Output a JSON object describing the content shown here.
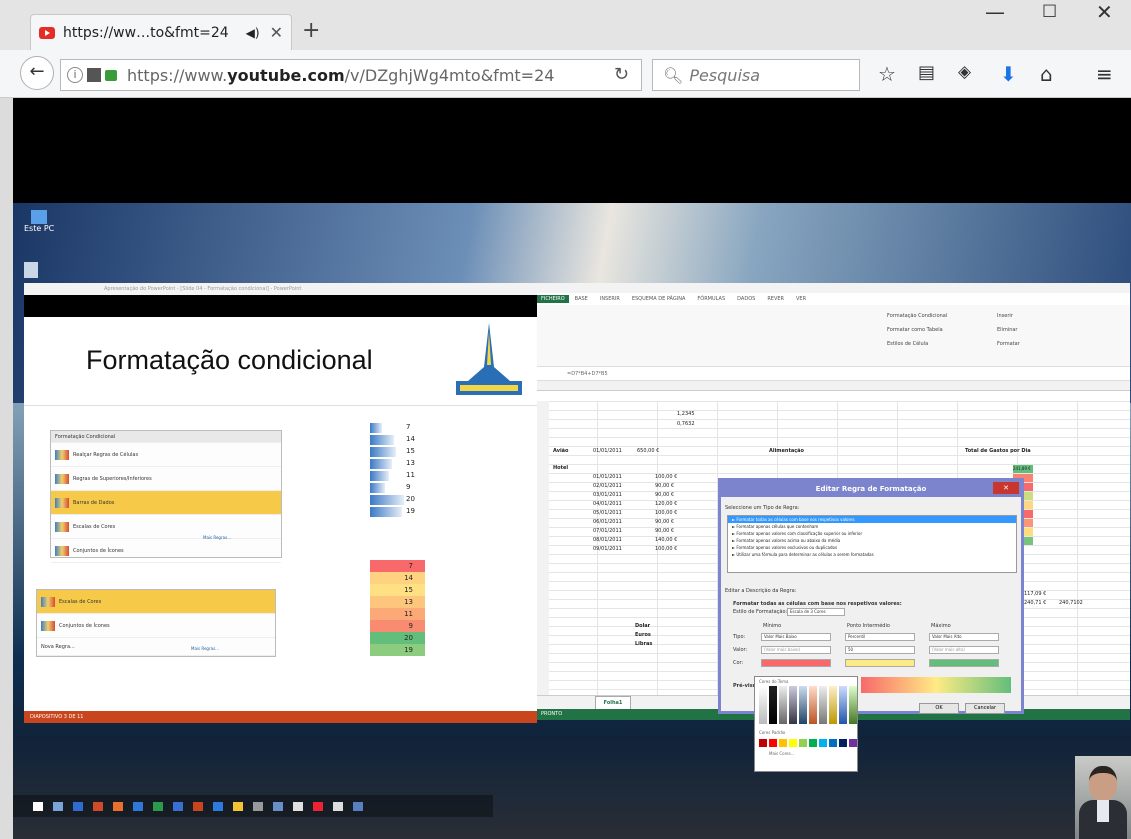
{
  "browser": {
    "tab_title": "https://ww…to&fmt=24",
    "url_prefix": "https://www.",
    "url_domain": "youtube.com",
    "url_path": "/v/DZghjWg4mto&fmt=24",
    "search_placeholder": "Pesquisa"
  },
  "ppt": {
    "title": "Formatação condicional",
    "window_title": "Apresentação do PowerPoint - [Slide 04 - Formatação condicional] - PowerPoint",
    "menu_top": [
      "Formatação Condicional",
      "Realçar Regras de Células",
      "Regras de Superiores/Inferiores",
      "Barras de Dados",
      "Escalas de Cores",
      "Conjuntos de Ícones",
      "Mais Regras..."
    ],
    "menu_bottom": [
      "Escalas de Cores",
      "Conjuntos de Ícones",
      "Nova Regra...",
      "Mais Regras..."
    ],
    "bar_values": [
      "7",
      "14",
      "15",
      "13",
      "11",
      "9",
      "20",
      "19"
    ],
    "scale_values": [
      "7",
      "14",
      "15",
      "13",
      "11",
      "9",
      "20",
      "19"
    ],
    "status": "DIAPOSITIVO 3 DE 11"
  },
  "excel": {
    "tabs": [
      "FICHEIRO",
      "BASE",
      "INSERIR",
      "ESQUEMA DE PÁGINA",
      "FÓRMULAS",
      "DADOS",
      "REVER",
      "VER"
    ],
    "ribbon_items": [
      "Formatação Condicional",
      "Formatar como Tabela",
      "Estilos de Célula",
      "Inserir",
      "Eliminar",
      "Formatar"
    ],
    "formula": "=D7*B4+D7*B5",
    "values_top": [
      "1,2345",
      "0,7632"
    ],
    "aviao": "Avião",
    "aviao_date": "01/01/2011",
    "aviao_val": "650,00 €",
    "alimentacao": "Alimentação",
    "total_gastos": "Total de Gastos por Dia",
    "hotel": "Hotel",
    "dates": [
      "01/01/2011",
      "02/01/2011",
      "03/01/2011",
      "04/01/2011",
      "05/01/2011",
      "06/01/2011",
      "07/01/2011",
      "08/01/2011",
      "09/01/2011"
    ],
    "amounts": [
      "100,00 €",
      "90,00 €",
      "90,00 €",
      "120,00 €",
      "100,00 €",
      "90,00 €",
      "90,00 €",
      "140,00 €",
      "100,00 €"
    ],
    "green_top": [
      "241,89 €"
    ],
    "currencies": [
      "Dolar",
      "Euros",
      "Libras"
    ],
    "totals": [
      "117,09 €",
      "240,71 €",
      "240,7102"
    ],
    "sheet_tab": "Folha1",
    "status": "PRONTO"
  },
  "dialog": {
    "title": "Editar Regra de Formatação",
    "section1": "Seleccione um Tipo de Regra:",
    "rules": [
      "► Formatar todas as células com base nos respetivos valores",
      "► Formatar apenas células que contenham",
      "► Formatar apenas valores com classificação superior ou inferior",
      "► Formatar apenas valores acima ou abaixo da média",
      "► Formatar apenas valores exclusivos ou duplicados",
      "► Utilizar uma fórmula para determinar as células a serem formatadas"
    ],
    "section2": "Editar a Descrição da Regra:",
    "desc_bold": "Formatar todas as células com base nos respetivos valores:",
    "style_label": "Estilo de Formatação:",
    "style_value": "Escala de 3 Cores",
    "col_min": "Mínimo",
    "col_mid": "Ponto Intermédio",
    "col_max": "Máximo",
    "row_type": "Tipo:",
    "row_value": "Valor:",
    "row_color": "Cor:",
    "min_type": "Valor Mais Baixo",
    "mid_type": "Percentil",
    "max_type": "Valor Mais Alto",
    "min_value": "(Valor mais baixo)",
    "mid_value": "50",
    "max_value": "(Valor mais alto)",
    "preview_label": "Pré-visualização:",
    "ok": "OK",
    "cancel": "Cancelar",
    "theme_colors": "Cores do Tema",
    "standard_colors": "Cores Padrão",
    "more_colors": "Mais Cores..."
  },
  "desktop": {
    "icon1": "Este PC"
  },
  "colors": {
    "youtube_red": "#e52d27",
    "excel_green": "#217346",
    "ppt_orange": "#c8451e",
    "dialog_border": "#7b84cc"
  }
}
